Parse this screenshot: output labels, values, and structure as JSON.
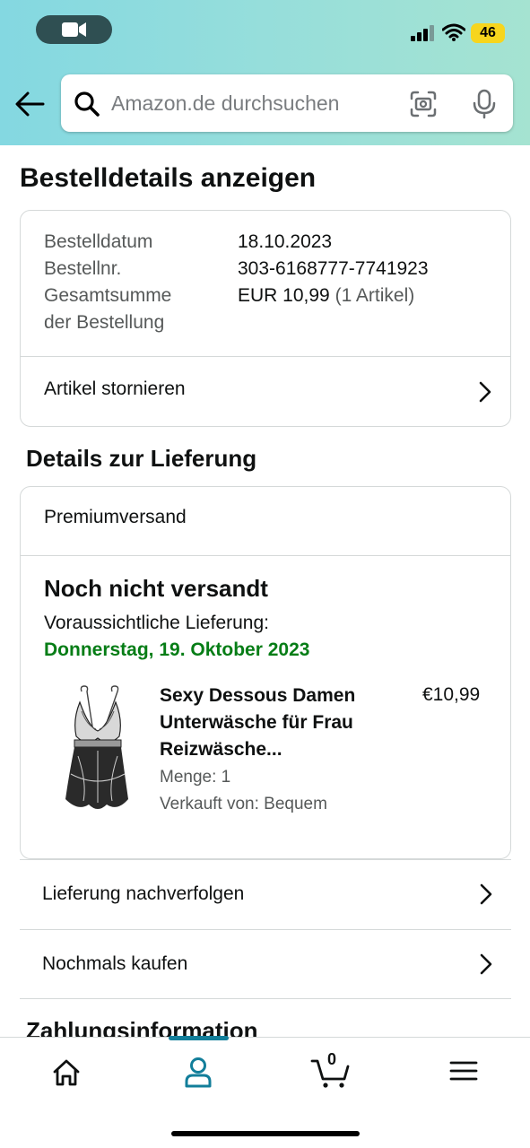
{
  "status_bar": {
    "battery": "46"
  },
  "search": {
    "placeholder": "Amazon.de durchsuchen"
  },
  "page_title": "Bestelldetails anzeigen",
  "order_summary": {
    "date_label": "Bestelldatum",
    "date_value": "18.10.2023",
    "number_label": "Bestellnr.",
    "number_value": "303-6168777-7741923",
    "total_label_1": "Gesamtsumme",
    "total_label_2": "der Bestellung",
    "total_value": "EUR 10,99",
    "total_items": "(1 Artikel)",
    "cancel_label": "Artikel stornieren"
  },
  "delivery": {
    "section_title": "Details zur Lieferung",
    "shipping_method": "Premiumversand",
    "status": "Noch nicht versandt",
    "expected_label": "Voraussichtliche Lieferung:",
    "expected_date": "Donnerstag, 19. Oktober 2023",
    "item": {
      "title": "Sexy Dessous Damen Unterwäsche für Frau Reizwäsche...",
      "price": "€10,99",
      "quantity": "Menge: 1",
      "seller": "Verkauft von: Bequem"
    }
  },
  "actions": {
    "track": "Lieferung nachverfolgen",
    "buy_again": "Nochmals kaufen"
  },
  "payment": {
    "section_title": "Zahlungsinformation"
  },
  "bottom_nav": {
    "cart_count": "0",
    "items": [
      "home-icon",
      "account-icon",
      "cart-icon",
      "menu-icon"
    ],
    "active": "account-icon"
  },
  "colors": {
    "accent": "#127e9a",
    "delivery_green": "#067d16",
    "header_gradient_start": "#84d8e1",
    "header_gradient_end": "#a5e3d1",
    "battery": "#f7d51d"
  }
}
